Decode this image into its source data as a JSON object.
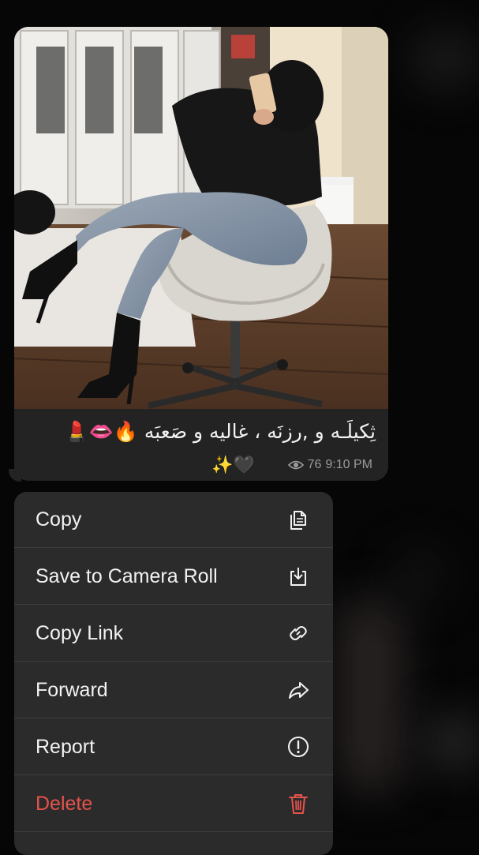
{
  "message": {
    "caption": "ثِكيلَـه و ,رزنَه ، غاليه و صَعبَه 🔥👄💄",
    "caption_line2": "✨🖤",
    "views": "76",
    "time": "9:10 PM"
  },
  "menu": {
    "items": [
      {
        "label": "Copy",
        "icon": "copy-icon"
      },
      {
        "label": "Save to Camera Roll",
        "icon": "save-download-icon"
      },
      {
        "label": "Copy Link",
        "icon": "link-icon"
      },
      {
        "label": "Forward",
        "icon": "forward-arrow-icon"
      },
      {
        "label": "Report",
        "icon": "exclamation-circle-icon"
      },
      {
        "label": "Delete",
        "icon": "trash-icon"
      }
    ]
  },
  "colors": {
    "background": "#060606",
    "bubble": "#232323",
    "menu": "#2b2b2b",
    "delete": "#e5534b",
    "meta": "#9a9a9a"
  }
}
